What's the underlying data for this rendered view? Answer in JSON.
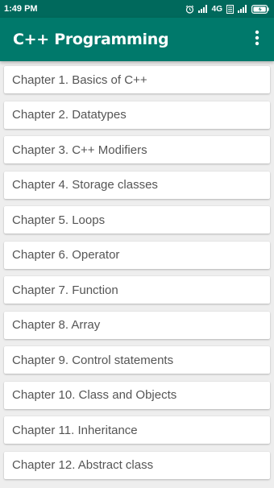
{
  "status_bar": {
    "time": "1:49 PM",
    "network": "4G",
    "icons": [
      "alarm-icon",
      "signal-icon",
      "network-type-icon",
      "signal-icon",
      "battery-icon"
    ]
  },
  "app_bar": {
    "title": "C++ Programming",
    "menu_icon": "more-vert-icon"
  },
  "colors": {
    "status_bar": "#00695c",
    "app_bar": "#00796b",
    "background": "#eeeeee",
    "card": "#ffffff",
    "item_text": "#555555"
  },
  "chapters": [
    {
      "label": "Chapter 1. Basics of C++"
    },
    {
      "label": "Chapter 2. Datatypes"
    },
    {
      "label": "Chapter 3. C++ Modifiers"
    },
    {
      "label": "Chapter 4. Storage classes"
    },
    {
      "label": "Chapter 5. Loops"
    },
    {
      "label": "Chapter 6. Operator"
    },
    {
      "label": "Chapter 7. Function"
    },
    {
      "label": "Chapter 8. Array"
    },
    {
      "label": "Chapter 9. Control statements"
    },
    {
      "label": "Chapter 10. Class and Objects"
    },
    {
      "label": "Chapter 11. Inheritance"
    },
    {
      "label": "Chapter 12. Abstract class"
    }
  ]
}
